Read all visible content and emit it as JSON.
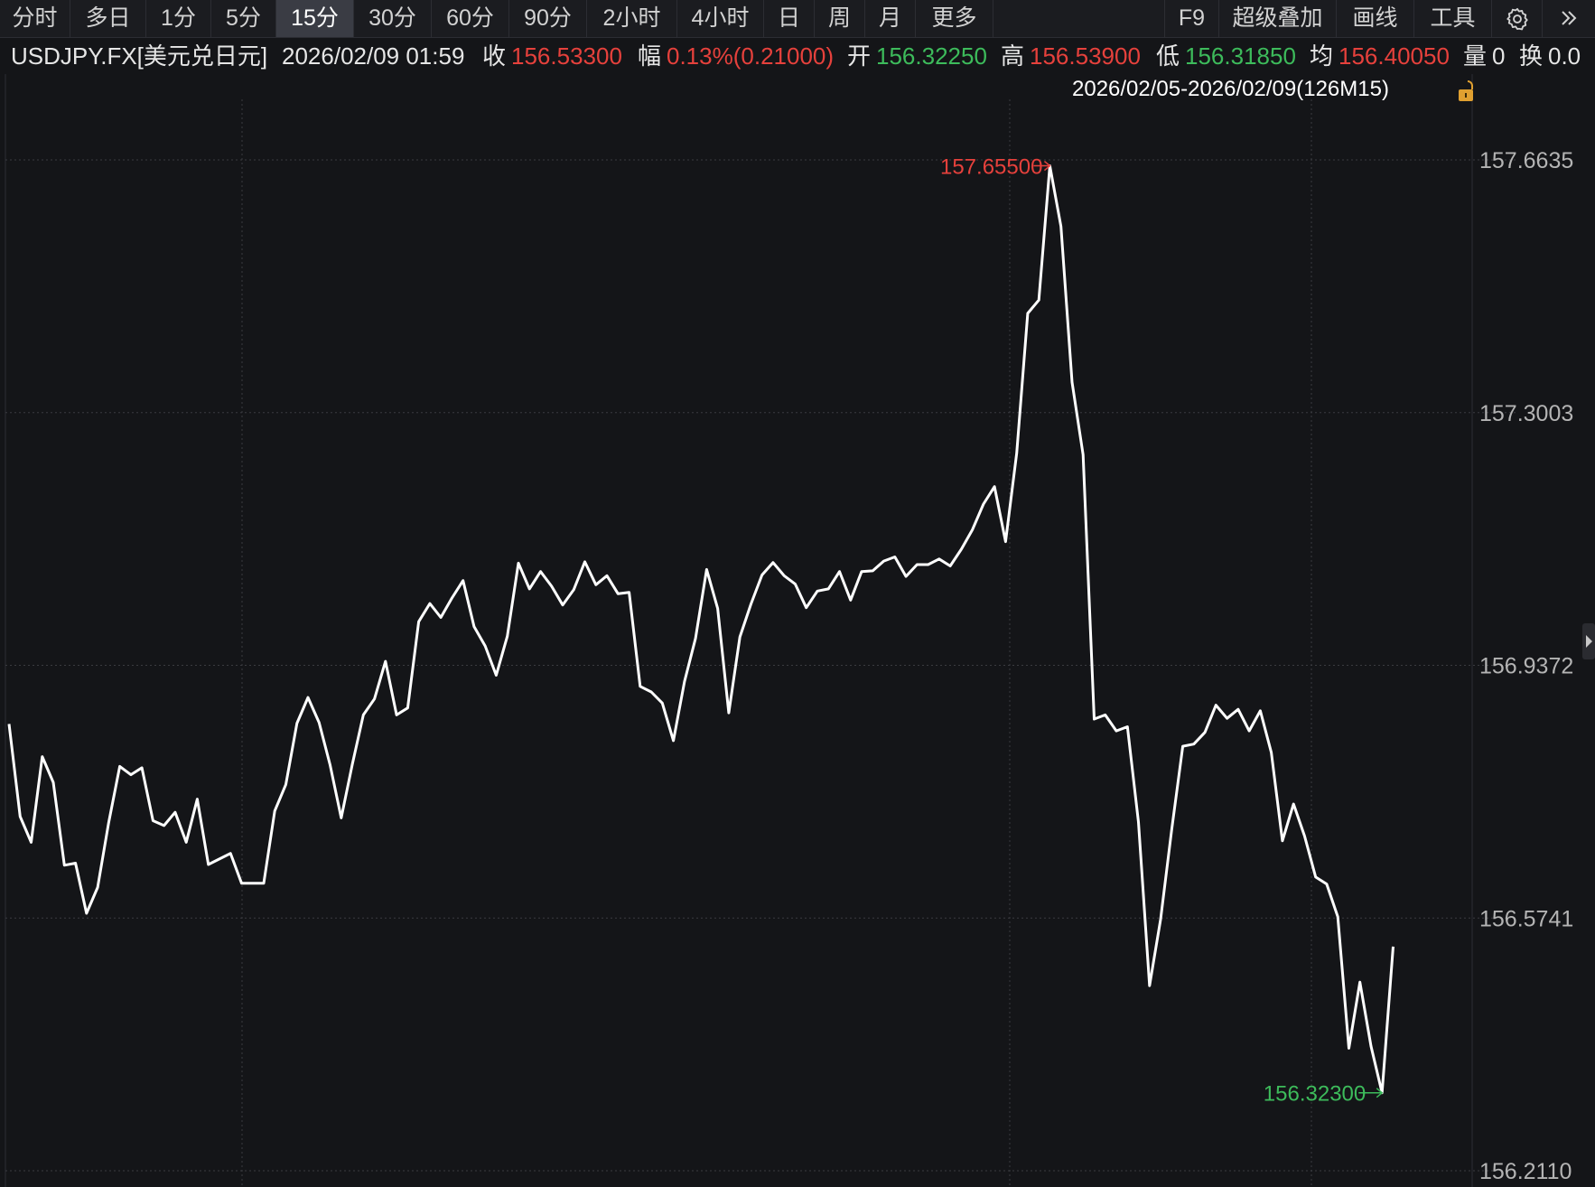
{
  "toolbar": {
    "periods": [
      "分时",
      "多日",
      "1分",
      "5分",
      "15分",
      "30分",
      "60分",
      "90分",
      "2小时",
      "4小时",
      "日",
      "周",
      "月",
      "更多"
    ],
    "active_period": "15分",
    "f9_label": "F9",
    "overlay_label": "超级叠加",
    "draw_label": "画线",
    "tools_label": "工具",
    "settings_icon": "gear-icon",
    "more_icon": "double-chevron-right-icon"
  },
  "quote": {
    "symbol": "USDJPY.FX[美元兑日元]",
    "datetime": "2026/02/09 01:59",
    "close_label": "收",
    "close": "156.53300",
    "change_label": "幅",
    "change": "0.13%(0.21000)",
    "open_label": "开",
    "open": "156.32250",
    "high_label": "高",
    "high": "156.53900",
    "low_label": "低",
    "low": "156.31850",
    "avg_label": "均",
    "avg": "156.40050",
    "volume_label": "量",
    "volume": "0",
    "turnover_label": "换",
    "turnover": "0.0"
  },
  "range_label": "2026/02/05-2026/02/09(126M15)",
  "colors": {
    "up": "#e6413c",
    "down": "#3dbb5b",
    "line": "#ffffff",
    "grid": "#3a3b40",
    "background": "#141518"
  },
  "chart_data": {
    "type": "line",
    "title": "",
    "xlabel": "",
    "ylabel": "",
    "ylim": [
      156.211,
      157.6635
    ],
    "yticks": [
      "157.6635",
      "157.3003",
      "156.9372",
      "156.5741",
      "156.2110"
    ],
    "grid": true,
    "series": [
      {
        "values": [
          156.853,
          156.72,
          156.683,
          156.806,
          156.769,
          156.65,
          156.653,
          156.581,
          156.618,
          156.711,
          156.792,
          156.78,
          156.79,
          156.714,
          156.707,
          156.726,
          156.683,
          156.745,
          156.651,
          156.659,
          156.667,
          156.624,
          156.624,
          156.624,
          156.728,
          156.766,
          156.854,
          156.891,
          156.855,
          156.794,
          156.718,
          156.795,
          156.866,
          156.889,
          156.943,
          156.866,
          156.876,
          157.0,
          157.026,
          157.006,
          157.034,
          157.059,
          156.993,
          156.965,
          156.923,
          156.979,
          157.084,
          157.047,
          157.072,
          157.051,
          157.024,
          157.046,
          157.086,
          157.053,
          157.066,
          157.04,
          157.042,
          156.907,
          156.899,
          156.883,
          156.829,
          156.914,
          156.976,
          157.075,
          157.019,
          156.869,
          156.978,
          157.025,
          157.067,
          157.085,
          157.066,
          157.054,
          157.02,
          157.044,
          157.047,
          157.072,
          157.031,
          157.072,
          157.073,
          157.087,
          157.093,
          157.065,
          157.082,
          157.082,
          157.09,
          157.08,
          157.104,
          157.132,
          157.169,
          157.194,
          157.115,
          157.242,
          157.443,
          157.462,
          157.655,
          157.568,
          157.344,
          157.24,
          156.86,
          156.866,
          156.843,
          156.849,
          156.712,
          156.477,
          156.572,
          156.701,
          156.821,
          156.824,
          156.841,
          156.88,
          156.861,
          156.874,
          156.843,
          156.872,
          156.812,
          156.685,
          156.738,
          156.692,
          156.633,
          156.623,
          156.576,
          156.387,
          156.482,
          156.39,
          156.323,
          156.533
        ],
        "high_label": "157.65500",
        "low_label": "156.32300"
      }
    ]
  }
}
